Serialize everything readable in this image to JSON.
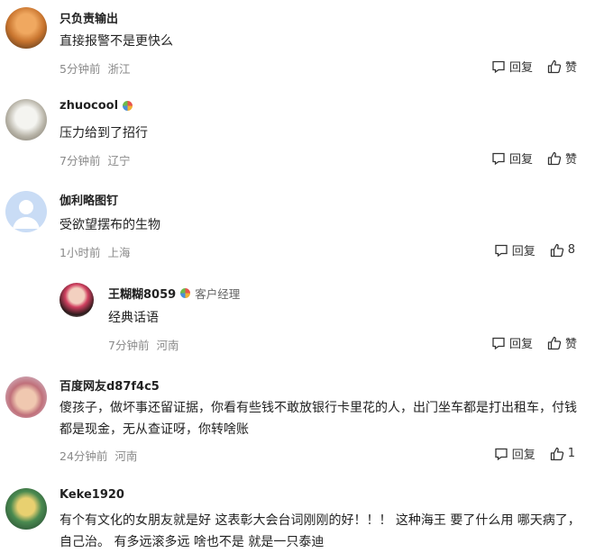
{
  "comments": [
    {
      "username": "只负责输出",
      "text": "直接报警不是更快么",
      "time": "5分钟前",
      "location": "浙江",
      "reply": "回复",
      "like": "赞"
    },
    {
      "username": "zhuocool",
      "text": "压力给到了招行",
      "time": "7分钟前",
      "location": "辽宁",
      "reply": "回复",
      "like": "赞"
    },
    {
      "username": "伽利略图钉",
      "text": "受欲望摆布的生物",
      "time": "1小时前",
      "location": "上海",
      "reply": "回复",
      "like": "8"
    },
    {
      "username": "王糊糊8059",
      "role": "客户经理",
      "text": "经典话语",
      "time": "7分钟前",
      "location": "河南",
      "reply": "回复",
      "like": "赞"
    },
    {
      "username": "百度网友d87f4c5",
      "text": "傻孩子，做坏事还留证据，你看有些钱不敢放银行卡里花的人，出门坐车都是打出租车，付钱都是现金，无从查证呀，你转啥账",
      "time": "24分钟前",
      "location": "河南",
      "reply": "回复",
      "like": "1"
    },
    {
      "username": "Keke1920",
      "text": "有个有文化的女朋友就是好 这表彰大会台词刚刚的好！！！ 这种海王 要了什么用 哪天病了，自己治。 有多远滚多远 啥也不是 就是一只泰迪"
    }
  ]
}
